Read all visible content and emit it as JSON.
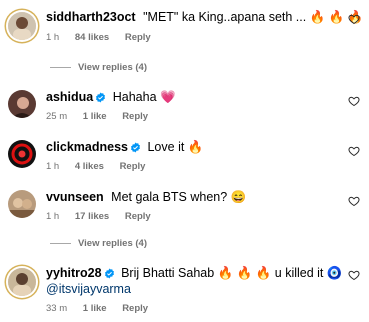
{
  "comments": [
    {
      "username": "siddharth23oct",
      "verified": false,
      "text": "\"MET\" ka King..apana seth ... 🔥 🔥 🔥",
      "time": "1 h",
      "likes": "84 likes",
      "reply": "Reply",
      "view_replies": "View replies (4)"
    },
    {
      "username": "ashidua",
      "verified": true,
      "text": "Hahaha 💗",
      "time": "25 m",
      "likes": "1 like",
      "reply": "Reply"
    },
    {
      "username": "clickmadness",
      "verified": true,
      "text": "Love it 🔥",
      "time": "1 h",
      "likes": "4 likes",
      "reply": "Reply"
    },
    {
      "username": "vvunseen",
      "verified": false,
      "text": "Met gala BTS when? 😄",
      "time": "1 h",
      "likes": "17 likes",
      "reply": "Reply",
      "view_replies": "View replies (4)"
    },
    {
      "username": "yyhitro28",
      "verified": true,
      "text": "Brij Bhatti Sahab 🔥 🔥 🔥 u killed it 🧿",
      "mention": "@itsvijayvarma",
      "time": "33 m",
      "likes": "1 like",
      "reply": "Reply"
    }
  ],
  "colors": {
    "verified_blue": "#0095f6",
    "meta_gray": "#737373",
    "mention_blue": "#00376b"
  },
  "icons": {
    "like": "heart-outline-icon",
    "verified": "verified-badge-icon"
  }
}
